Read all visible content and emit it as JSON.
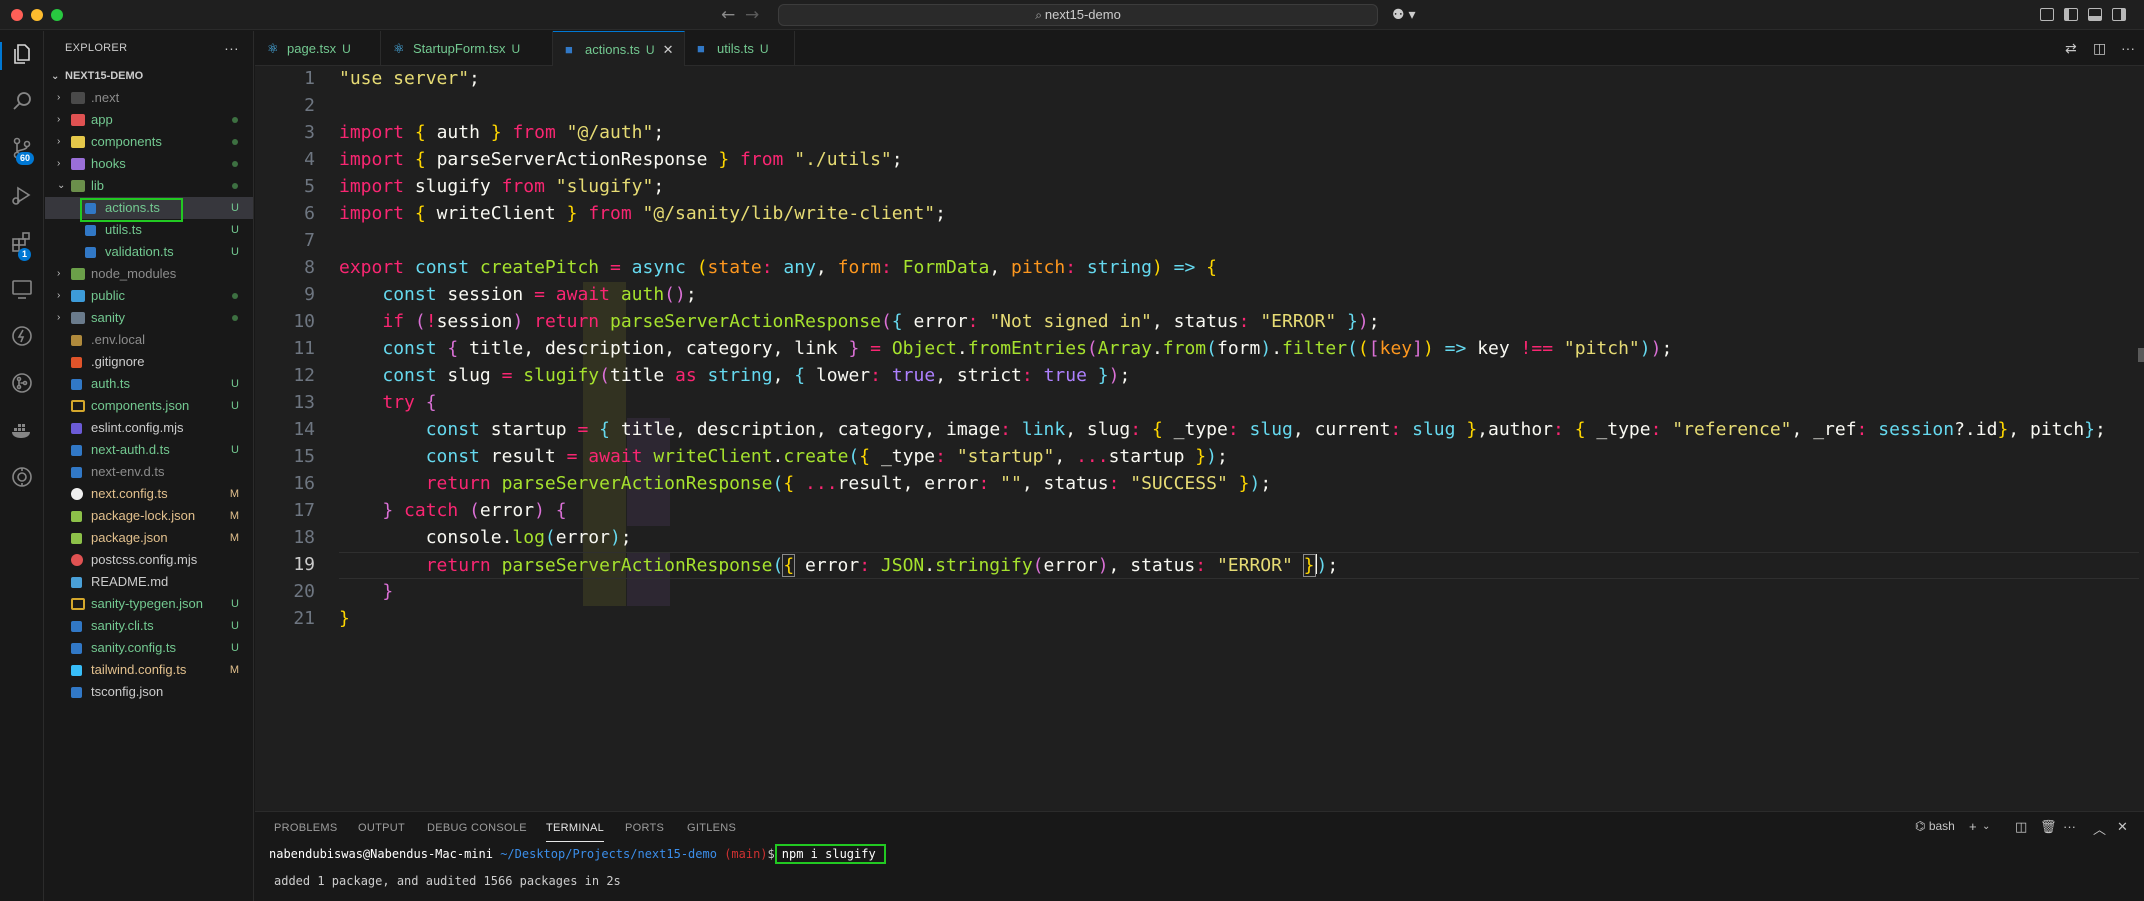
{
  "window": {
    "title": "next15-demo"
  },
  "activity": {
    "source_control_badge": "60",
    "extensions_badge": "1"
  },
  "sidebar": {
    "header": "EXPLORER",
    "more": "···",
    "root": "NEXT15-DEMO",
    "items": [
      {
        "name": ".next",
        "status": ""
      },
      {
        "name": "app",
        "status": ""
      },
      {
        "name": "components",
        "status": ""
      },
      {
        "name": "hooks",
        "status": ""
      },
      {
        "name": "lib",
        "status": ""
      },
      {
        "name": "actions.ts",
        "status": "U"
      },
      {
        "name": "utils.ts",
        "status": "U"
      },
      {
        "name": "validation.ts",
        "status": "U"
      },
      {
        "name": "node_modules",
        "status": ""
      },
      {
        "name": "public",
        "status": ""
      },
      {
        "name": "sanity",
        "status": ""
      },
      {
        "name": ".env.local",
        "status": ""
      },
      {
        "name": ".gitignore",
        "status": ""
      },
      {
        "name": "auth.ts",
        "status": "U"
      },
      {
        "name": "components.json",
        "status": "U"
      },
      {
        "name": "eslint.config.mjs",
        "status": ""
      },
      {
        "name": "next-auth.d.ts",
        "status": "U"
      },
      {
        "name": "next-env.d.ts",
        "status": ""
      },
      {
        "name": "next.config.ts",
        "status": "M"
      },
      {
        "name": "package-lock.json",
        "status": "M"
      },
      {
        "name": "package.json",
        "status": "M"
      },
      {
        "name": "postcss.config.mjs",
        "status": ""
      },
      {
        "name": "README.md",
        "status": ""
      },
      {
        "name": "sanity-typegen.json",
        "status": "U"
      },
      {
        "name": "sanity.cli.ts",
        "status": "U"
      },
      {
        "name": "sanity.config.ts",
        "status": "U"
      },
      {
        "name": "tailwind.config.ts",
        "status": "M"
      },
      {
        "name": "tsconfig.json",
        "status": ""
      }
    ]
  },
  "tabs": [
    {
      "label": "page.tsx",
      "mark": "U"
    },
    {
      "label": "StartupForm.tsx",
      "mark": "U"
    },
    {
      "label": "actions.ts",
      "mark": "U"
    },
    {
      "label": "utils.ts",
      "mark": "U"
    }
  ],
  "editor": {
    "line_numbers": [
      "1",
      "2",
      "3",
      "4",
      "5",
      "6",
      "7",
      "8",
      "9",
      "10",
      "11",
      "12",
      "13",
      "14",
      "15",
      "16",
      "17",
      "18",
      "19",
      "20",
      "21"
    ],
    "current_line": "19"
  },
  "panel": {
    "tabs": [
      "PROBLEMS",
      "OUTPUT",
      "DEBUG CONSOLE",
      "TERMINAL",
      "PORTS",
      "GITLENS"
    ],
    "active_tab": "TERMINAL",
    "shell": "bash",
    "prompt_user": "nabendubiswas@Nabendus-Mac-mini",
    "prompt_path": "~/Desktop/Projects/next15-demo",
    "prompt_branch": "(main)",
    "prompt_symbol": "$",
    "command": "npm i slugify",
    "output": "added 1 package, and audited 1566 packages in 2s"
  },
  "colors": {
    "accent": "#0078d4",
    "highlight_box": "#22c922",
    "untracked": "#73c991",
    "modified": "#e2c08d"
  }
}
